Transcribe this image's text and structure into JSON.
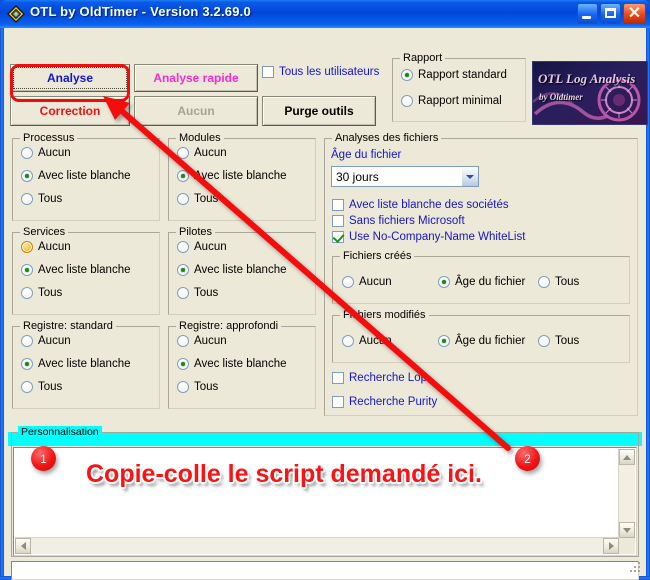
{
  "window": {
    "title": "OTL by OldTimer - Version 3.2.69.0",
    "icon": "otl-diamond-icon",
    "minimize_label": "",
    "maximize_label": "",
    "close_label": "✕",
    "accent": "#0047d8"
  },
  "toolbar": {
    "analyse_label": "Analyse",
    "analyse_rapide_label": "Analyse rapide",
    "correction_label": "Correction",
    "aucun_label": "Aucun",
    "purge_outils_label": "Purge outils",
    "tous_les_utilisateurs_label": "Tous les utilisateurs",
    "tous_les_utilisateurs_checked": false
  },
  "rapport": {
    "legend": "Rapport",
    "options": [
      {
        "label": "Rapport standard",
        "selected": true
      },
      {
        "label": "Rapport minimal",
        "selected": false
      }
    ]
  },
  "logo": {
    "line1": "OTL Log Analysis",
    "line2": "by Oldtimer"
  },
  "groups": [
    {
      "legend": "Processus",
      "options": [
        {
          "label": "Aucun",
          "selected": false,
          "hover": false
        },
        {
          "label": "Avec liste blanche",
          "selected": true,
          "hover": false
        },
        {
          "label": "Tous",
          "selected": false,
          "hover": false
        }
      ]
    },
    {
      "legend": "Modules",
      "options": [
        {
          "label": "Aucun",
          "selected": false,
          "hover": false
        },
        {
          "label": "Avec liste blanche",
          "selected": true,
          "hover": false
        },
        {
          "label": "Tous",
          "selected": false,
          "hover": false
        }
      ]
    },
    {
      "legend": "Services",
      "options": [
        {
          "label": "Aucun",
          "selected": false,
          "hover": true
        },
        {
          "label": "Avec liste blanche",
          "selected": true,
          "hover": false
        },
        {
          "label": "Tous",
          "selected": false,
          "hover": false
        }
      ]
    },
    {
      "legend": "Pilotes",
      "options": [
        {
          "label": "Aucun",
          "selected": false,
          "hover": false
        },
        {
          "label": "Avec liste blanche",
          "selected": true,
          "hover": false
        },
        {
          "label": "Tous",
          "selected": false,
          "hover": false
        }
      ]
    },
    {
      "legend": "Registre: standard",
      "options": [
        {
          "label": "Aucun",
          "selected": false,
          "hover": false
        },
        {
          "label": "Avec liste blanche",
          "selected": true,
          "hover": false
        },
        {
          "label": "Tous",
          "selected": false,
          "hover": false
        }
      ]
    },
    {
      "legend": "Registre: approfondi",
      "options": [
        {
          "label": "Aucun",
          "selected": false,
          "hover": false
        },
        {
          "label": "Avec liste blanche",
          "selected": true,
          "hover": false
        },
        {
          "label": "Tous",
          "selected": false,
          "hover": false
        }
      ]
    }
  ],
  "analyses": {
    "legend": "Analyses des fichiers",
    "age_label": "Âge du fichier",
    "age_value": "30 jours",
    "checkboxes": [
      {
        "label": "Avec liste blanche des sociétés",
        "checked": false
      },
      {
        "label": "Sans fichiers Microsoft",
        "checked": false
      },
      {
        "label": "Use No-Company-Name WhiteList",
        "checked": true
      }
    ],
    "fichiers_crees": {
      "legend": "Fichiers créés",
      "options": [
        {
          "label": "Aucun",
          "selected": false
        },
        {
          "label": "Âge du fichier",
          "selected": true
        },
        {
          "label": "Tous",
          "selected": false
        }
      ]
    },
    "fichiers_modifies": {
      "legend": "Fichiers modifiés",
      "options": [
        {
          "label": "Aucun",
          "selected": false
        },
        {
          "label": "Âge du fichier",
          "selected": true
        },
        {
          "label": "Tous",
          "selected": false
        }
      ]
    },
    "bottom_checkboxes": [
      {
        "label": "Recherche Lop",
        "checked": false
      },
      {
        "label": "Recherche Purity",
        "checked": false
      }
    ]
  },
  "personnalisation": {
    "legend": "Personnalisation",
    "memo_value": "",
    "memo_placeholder": "",
    "status_value": ""
  },
  "annotation": {
    "badge_one": "1",
    "badge_two": "2",
    "instruction": "Copie-colle le script demandé ici.",
    "color": "#f30b0b"
  }
}
